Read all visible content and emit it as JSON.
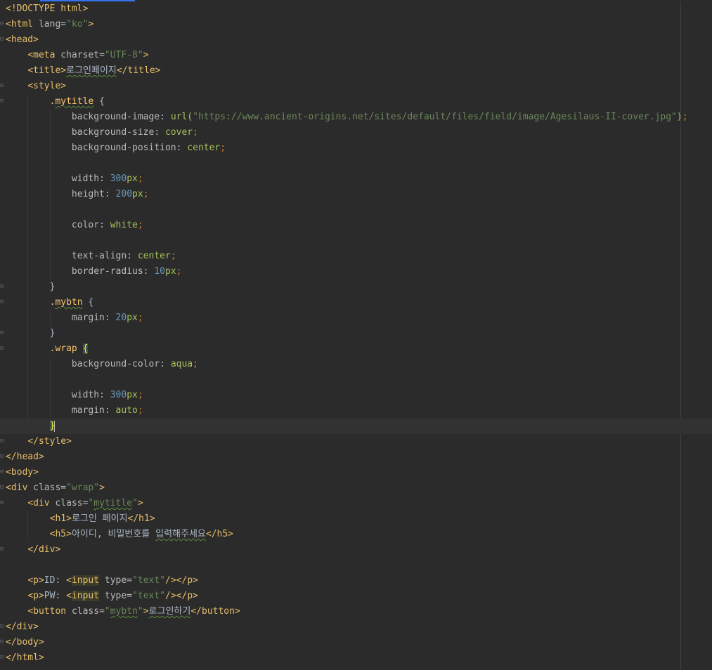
{
  "editor": {
    "lines": [
      {
        "indent": 0,
        "fold": false,
        "segments": [
          [
            "tag",
            "<!DOCTYPE html>"
          ]
        ]
      },
      {
        "indent": 0,
        "fold": true,
        "segments": [
          [
            "tag",
            "<html "
          ],
          [
            "attr",
            "lang="
          ],
          [
            "str",
            "\"ko\""
          ],
          [
            "tag",
            ">"
          ]
        ]
      },
      {
        "indent": 0,
        "fold": true,
        "segments": [
          [
            "tag",
            "<head>"
          ]
        ]
      },
      {
        "indent": 1,
        "fold": false,
        "segments": [
          [
            "tag",
            "<meta "
          ],
          [
            "attr",
            "charset="
          ],
          [
            "str",
            "\"UTF-8\""
          ],
          [
            "tag",
            ">"
          ]
        ]
      },
      {
        "indent": 1,
        "fold": false,
        "segments": [
          [
            "tag",
            "<title>"
          ],
          [
            "typo",
            "로그인페이지"
          ],
          [
            "tag",
            "</title>"
          ]
        ]
      },
      {
        "indent": 1,
        "fold": true,
        "segments": [
          [
            "tag",
            "<style>"
          ]
        ]
      },
      {
        "indent": 2,
        "fold": true,
        "segments": [
          [
            "sel",
            "."
          ],
          [
            "seltypo",
            "mytitle"
          ],
          [
            "brace",
            " {"
          ]
        ]
      },
      {
        "indent": 3,
        "fold": false,
        "segments": [
          [
            "prop",
            "background-image"
          ],
          [
            "txt",
            ": "
          ],
          [
            "val",
            "url("
          ],
          [
            "str",
            "\"https://www.ancient-origins.net/sites/default/files/field/image/Agesilaus-II-cover.jpg\""
          ],
          [
            "val",
            ")"
          ],
          [
            "punct",
            ";"
          ]
        ]
      },
      {
        "indent": 3,
        "fold": false,
        "segments": [
          [
            "prop",
            "background-size"
          ],
          [
            "txt",
            ": "
          ],
          [
            "val",
            "cover"
          ],
          [
            "punct",
            ";"
          ]
        ]
      },
      {
        "indent": 3,
        "fold": false,
        "segments": [
          [
            "prop",
            "background-position"
          ],
          [
            "txt",
            ": "
          ],
          [
            "val",
            "center"
          ],
          [
            "punct",
            ";"
          ]
        ]
      },
      {
        "indent": 3,
        "fold": false,
        "segments": []
      },
      {
        "indent": 3,
        "fold": false,
        "segments": [
          [
            "prop",
            "width"
          ],
          [
            "txt",
            ": "
          ],
          [
            "num",
            "300"
          ],
          [
            "val",
            "px"
          ],
          [
            "punct",
            ";"
          ]
        ]
      },
      {
        "indent": 3,
        "fold": false,
        "segments": [
          [
            "prop",
            "height"
          ],
          [
            "txt",
            ": "
          ],
          [
            "num",
            "200"
          ],
          [
            "val",
            "px"
          ],
          [
            "punct",
            ";"
          ]
        ]
      },
      {
        "indent": 3,
        "fold": false,
        "segments": []
      },
      {
        "indent": 3,
        "fold": false,
        "segments": [
          [
            "prop",
            "color"
          ],
          [
            "txt",
            ": "
          ],
          [
            "val",
            "white"
          ],
          [
            "punct",
            ";"
          ]
        ]
      },
      {
        "indent": 3,
        "fold": false,
        "segments": []
      },
      {
        "indent": 3,
        "fold": false,
        "segments": [
          [
            "prop",
            "text-align"
          ],
          [
            "txt",
            ": "
          ],
          [
            "val",
            "center"
          ],
          [
            "punct",
            ";"
          ]
        ]
      },
      {
        "indent": 3,
        "fold": false,
        "segments": [
          [
            "prop",
            "border-radius"
          ],
          [
            "txt",
            ": "
          ],
          [
            "num",
            "10"
          ],
          [
            "val",
            "px"
          ],
          [
            "punct",
            ";"
          ]
        ]
      },
      {
        "indent": 2,
        "fold": true,
        "segments": [
          [
            "brace",
            "}"
          ]
        ]
      },
      {
        "indent": 2,
        "fold": true,
        "segments": [
          [
            "sel",
            "."
          ],
          [
            "seltypo",
            "mybtn"
          ],
          [
            "brace",
            " {"
          ]
        ]
      },
      {
        "indent": 3,
        "fold": false,
        "segments": [
          [
            "prop",
            "margin"
          ],
          [
            "txt",
            ": "
          ],
          [
            "num",
            "20"
          ],
          [
            "val",
            "px"
          ],
          [
            "punct",
            ";"
          ]
        ]
      },
      {
        "indent": 2,
        "fold": true,
        "segments": [
          [
            "brace",
            "}"
          ]
        ]
      },
      {
        "indent": 2,
        "fold": true,
        "segments": [
          [
            "sel",
            ".wrap "
          ],
          [
            "bracehl",
            "{"
          ]
        ]
      },
      {
        "indent": 3,
        "fold": false,
        "segments": [
          [
            "prop",
            "background-color"
          ],
          [
            "txt",
            ": "
          ],
          [
            "val",
            "aqua"
          ],
          [
            "punct",
            ";"
          ]
        ]
      },
      {
        "indent": 3,
        "fold": false,
        "segments": []
      },
      {
        "indent": 3,
        "fold": false,
        "segments": [
          [
            "prop",
            "width"
          ],
          [
            "txt",
            ": "
          ],
          [
            "num",
            "300"
          ],
          [
            "val",
            "px"
          ],
          [
            "punct",
            ";"
          ]
        ]
      },
      {
        "indent": 3,
        "fold": false,
        "segments": [
          [
            "prop",
            "margin"
          ],
          [
            "txt",
            ": "
          ],
          [
            "val",
            "auto"
          ],
          [
            "punct",
            ";"
          ]
        ]
      },
      {
        "indent": 2,
        "fold": false,
        "current": true,
        "segments": [
          [
            "bracehl",
            "}"
          ],
          [
            "caret",
            ""
          ]
        ]
      },
      {
        "indent": 1,
        "fold": true,
        "segments": [
          [
            "tag",
            "</style>"
          ]
        ]
      },
      {
        "indent": 0,
        "fold": true,
        "segments": [
          [
            "tag",
            "</head>"
          ]
        ]
      },
      {
        "indent": 0,
        "fold": true,
        "segments": [
          [
            "tag",
            "<body>"
          ]
        ]
      },
      {
        "indent": 0,
        "fold": true,
        "segments": [
          [
            "tag",
            "<div "
          ],
          [
            "attr",
            "class="
          ],
          [
            "str",
            "\"wrap\""
          ],
          [
            "tag",
            ">"
          ]
        ]
      },
      {
        "indent": 1,
        "fold": true,
        "segments": [
          [
            "tag",
            "<div "
          ],
          [
            "attr",
            "class="
          ],
          [
            "str",
            "\""
          ],
          [
            "strtypo",
            "mytitle"
          ],
          [
            "str",
            "\""
          ],
          [
            "tag",
            ">"
          ]
        ]
      },
      {
        "indent": 2,
        "fold": false,
        "segments": [
          [
            "tag",
            "<h1>"
          ],
          [
            "txt",
            "로그인 페이지"
          ],
          [
            "tag",
            "</h1>"
          ]
        ]
      },
      {
        "indent": 2,
        "fold": false,
        "segments": [
          [
            "tag",
            "<h5>"
          ],
          [
            "txt",
            "아이디, 비밀번호를 "
          ],
          [
            "typo",
            "입력해주세요"
          ],
          [
            "tag",
            "</h5>"
          ]
        ]
      },
      {
        "indent": 1,
        "fold": true,
        "segments": [
          [
            "tag",
            "</div>"
          ]
        ]
      },
      {
        "indent": 1,
        "fold": false,
        "segments": []
      },
      {
        "indent": 1,
        "fold": false,
        "segments": [
          [
            "tag",
            "<p>"
          ],
          [
            "txt",
            "ID: "
          ],
          [
            "tag",
            "<"
          ],
          [
            "taghl",
            "input"
          ],
          [
            "attr",
            " type="
          ],
          [
            "str",
            "\"text\""
          ],
          [
            "tag",
            "/></p>"
          ]
        ]
      },
      {
        "indent": 1,
        "fold": false,
        "segments": [
          [
            "tag",
            "<p>"
          ],
          [
            "txt",
            "PW: "
          ],
          [
            "tag",
            "<"
          ],
          [
            "taghl",
            "input"
          ],
          [
            "attr",
            " type="
          ],
          [
            "str",
            "\"text\""
          ],
          [
            "tag",
            "/></p>"
          ]
        ]
      },
      {
        "indent": 1,
        "fold": false,
        "segments": [
          [
            "tag",
            "<button "
          ],
          [
            "attr",
            "class="
          ],
          [
            "str",
            "\""
          ],
          [
            "strtypo",
            "mybtn"
          ],
          [
            "str",
            "\""
          ],
          [
            "tag",
            ">"
          ],
          [
            "typo",
            "로그인하기"
          ],
          [
            "tag",
            "</button>"
          ]
        ]
      },
      {
        "indent": 0,
        "fold": true,
        "segments": [
          [
            "tag",
            "</div>"
          ]
        ]
      },
      {
        "indent": 0,
        "fold": true,
        "segments": [
          [
            "tag",
            "</body>"
          ]
        ]
      },
      {
        "indent": 0,
        "fold": true,
        "segments": [
          [
            "tag",
            "</html>"
          ]
        ]
      }
    ]
  }
}
